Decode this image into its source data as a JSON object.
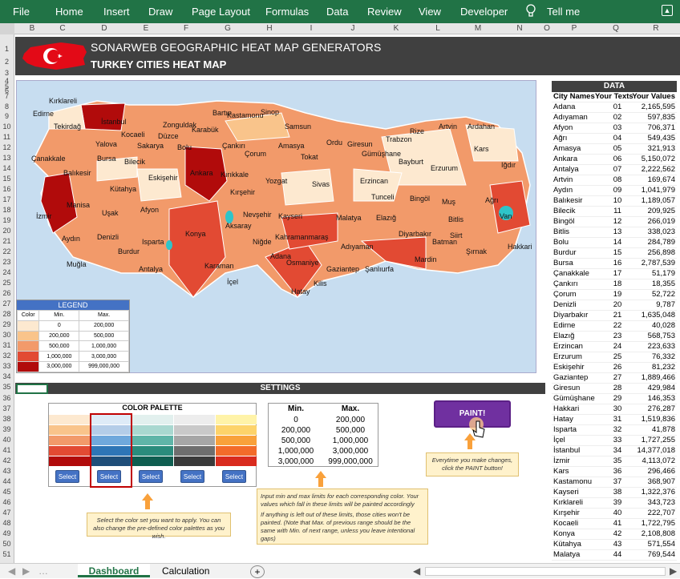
{
  "ribbon": {
    "tabs": [
      "File",
      "Home",
      "Insert",
      "Draw",
      "Page Layout",
      "Formulas",
      "Data",
      "Review",
      "View",
      "Developer",
      "Tell me"
    ]
  },
  "columns": [
    "B",
    "C",
    "D",
    "E",
    "F",
    "G",
    "H",
    "I",
    "J",
    "K",
    "L",
    "M",
    "N",
    "O",
    "P",
    "Q",
    "R"
  ],
  "rows": [
    "1",
    "2",
    "3",
    "4",
    "5",
    "6",
    "7",
    "8",
    "9",
    "10",
    "11",
    "12",
    "13",
    "14",
    "15",
    "16",
    "17",
    "18",
    "19",
    "20",
    "21",
    "22",
    "23",
    "24",
    "25",
    "26",
    "27",
    "28",
    "29",
    "30",
    "31",
    "32",
    "33",
    "34",
    "35",
    "36",
    "37",
    "38",
    "39",
    "40",
    "41",
    "42",
    "43",
    "44",
    "45",
    "46",
    "47",
    "48",
    "49",
    "50",
    "51"
  ],
  "header": {
    "title": "SONARWEB GEOGRAPHIC HEAT MAP GENERATORS",
    "subtitle": "TURKEY CITIES HEAT MAP"
  },
  "map": {
    "cities": [
      {
        "n": "Kırklareli"
      },
      {
        "n": "Edirne"
      },
      {
        "n": "İstanbul"
      },
      {
        "n": "Tekirdağ"
      },
      {
        "n": "Kocaeli"
      },
      {
        "n": "Zonguldak"
      },
      {
        "n": "Bartın"
      },
      {
        "n": "Kastamonu"
      },
      {
        "n": "Sinop"
      },
      {
        "n": "Samsun"
      },
      {
        "n": "Karabük"
      },
      {
        "n": "Düzce"
      },
      {
        "n": "Yalova"
      },
      {
        "n": "Sakarya"
      },
      {
        "n": "Bolu"
      },
      {
        "n": "Çankırı"
      },
      {
        "n": "Çorum"
      },
      {
        "n": "Amasya"
      },
      {
        "n": "Ordu"
      },
      {
        "n": "Giresun"
      },
      {
        "n": "Trabzon"
      },
      {
        "n": "Rize"
      },
      {
        "n": "Artvin"
      },
      {
        "n": "Ardahan"
      },
      {
        "n": "Gümüşhane"
      },
      {
        "n": "Kars"
      },
      {
        "n": "Bayburt"
      },
      {
        "n": "Tokat"
      },
      {
        "n": "Çanakkale"
      },
      {
        "n": "Bursa"
      },
      {
        "n": "Bilecik"
      },
      {
        "n": "Balıkesir"
      },
      {
        "n": "Eskişehir"
      },
      {
        "n": "Ankara"
      },
      {
        "n": "Kırıkkale"
      },
      {
        "n": "Erzurum"
      },
      {
        "n": "Iğdır"
      },
      {
        "n": "Kütahya"
      },
      {
        "n": "Yozgat"
      },
      {
        "n": "Sivas"
      },
      {
        "n": "Erzincan"
      },
      {
        "n": "Kırşehir"
      },
      {
        "n": "Tunceli"
      },
      {
        "n": "Bingöl"
      },
      {
        "n": "Ağrı"
      },
      {
        "n": "Manisa"
      },
      {
        "n": "Uşak"
      },
      {
        "n": "Afyon"
      },
      {
        "n": "Muş"
      },
      {
        "n": "Nevşehir"
      },
      {
        "n": "Kayseri"
      },
      {
        "n": "Malatya"
      },
      {
        "n": "Elazığ"
      },
      {
        "n": "Bitlis"
      },
      {
        "n": "Van"
      },
      {
        "n": "İzmir"
      },
      {
        "n": "Aksaray"
      },
      {
        "n": "Konya"
      },
      {
        "n": "Diyarbakır"
      },
      {
        "n": "Aydın"
      },
      {
        "n": "Denizli"
      },
      {
        "n": "Kahramanmaraş"
      },
      {
        "n": "Siirt"
      },
      {
        "n": "Isparta"
      },
      {
        "n": "Niğde"
      },
      {
        "n": "Adıyaman"
      },
      {
        "n": "Batman"
      },
      {
        "n": "Burdur"
      },
      {
        "n": "Şırnak"
      },
      {
        "n": "Hakkari"
      },
      {
        "n": "Muğla"
      },
      {
        "n": "Antalya"
      },
      {
        "n": "Karaman"
      },
      {
        "n": "Adana"
      },
      {
        "n": "Mardin"
      },
      {
        "n": "Osmaniye"
      },
      {
        "n": "Gaziantep"
      },
      {
        "n": "Şanlıurfa"
      },
      {
        "n": "İçel"
      },
      {
        "n": "Kilis"
      },
      {
        "n": "Hatay"
      }
    ]
  },
  "legend": {
    "title": "LEGEND",
    "col_color": "Color",
    "col_min": "Min.",
    "col_max": "Max.",
    "rows": [
      {
        "min": "0",
        "max": "200,000",
        "color": "#fde9d0"
      },
      {
        "min": "200,000",
        "max": "500,000",
        "color": "#f9c48b"
      },
      {
        "min": "500,000",
        "max": "1,000,000",
        "color": "#f29a6a"
      },
      {
        "min": "1,000,000",
        "max": "3,000,000",
        "color": "#e24a33"
      },
      {
        "min": "3,000,000",
        "max": "999,000,000",
        "color": "#b10b0b"
      }
    ]
  },
  "data_table": {
    "title": "DATA",
    "col1": "City Names",
    "col2": "Your Texts",
    "col3": "Your Values",
    "rows": [
      [
        "Adana",
        "01",
        "2,165,595"
      ],
      [
        "Adıyaman",
        "02",
        "597,835"
      ],
      [
        "Afyon",
        "03",
        "706,371"
      ],
      [
        "Ağrı",
        "04",
        "549,435"
      ],
      [
        "Amasya",
        "05",
        "321,913"
      ],
      [
        "Ankara",
        "06",
        "5,150,072"
      ],
      [
        "Antalya",
        "07",
        "2,222,562"
      ],
      [
        "Artvin",
        "08",
        "169,674"
      ],
      [
        "Aydın",
        "09",
        "1,041,979"
      ],
      [
        "Balıkesir",
        "10",
        "1,189,057"
      ],
      [
        "Bilecik",
        "11",
        "209,925"
      ],
      [
        "Bingöl",
        "12",
        "266,019"
      ],
      [
        "Bitlis",
        "13",
        "338,023"
      ],
      [
        "Bolu",
        "14",
        "284,789"
      ],
      [
        "Burdur",
        "15",
        "256,898"
      ],
      [
        "Bursa",
        "16",
        "2,787,539"
      ],
      [
        "Çanakkale",
        "17",
        "51,179"
      ],
      [
        "Çankırı",
        "18",
        "18,355"
      ],
      [
        "Çorum",
        "19",
        "52,722"
      ],
      [
        "Denizli",
        "20",
        "9,787"
      ],
      [
        "Diyarbakır",
        "21",
        "1,635,048"
      ],
      [
        "Edirne",
        "22",
        "40,028"
      ],
      [
        "Elazığ",
        "23",
        "568,753"
      ],
      [
        "Erzincan",
        "24",
        "223,633"
      ],
      [
        "Erzurum",
        "25",
        "76,332"
      ],
      [
        "Eskişehir",
        "26",
        "81,232"
      ],
      [
        "Gaziantep",
        "27",
        "1,889,466"
      ],
      [
        "Giresun",
        "28",
        "429,984"
      ],
      [
        "Gümüşhane",
        "29",
        "146,353"
      ],
      [
        "Hakkari",
        "30",
        "276,287"
      ],
      [
        "Hatay",
        "31",
        "1,519,836"
      ],
      [
        "Isparta",
        "32",
        "41,878"
      ],
      [
        "İçel",
        "33",
        "1,727,255"
      ],
      [
        "İstanbul",
        "34",
        "14,377,018"
      ],
      [
        "İzmir",
        "35",
        "4,113,072"
      ],
      [
        "Kars",
        "36",
        "296,466"
      ],
      [
        "Kastamonu",
        "37",
        "368,907"
      ],
      [
        "Kayseri",
        "38",
        "1,322,376"
      ],
      [
        "Kırklareli",
        "39",
        "343,723"
      ],
      [
        "Kırşehir",
        "40",
        "222,707"
      ],
      [
        "Kocaeli",
        "41",
        "1,722,795"
      ],
      [
        "Konya",
        "42",
        "2,108,808"
      ],
      [
        "Kütahya",
        "43",
        "571,554"
      ],
      [
        "Malatya",
        "44",
        "769,544"
      ]
    ]
  },
  "settings": {
    "title": "SETTINGS",
    "palette_title": "COLOR PALETTE",
    "select_label": "Select",
    "palettes": [
      [
        "#fde9d0",
        "#f9c48b",
        "#f29a6a",
        "#e24a33",
        "#b10b0b"
      ],
      [
        "#deebf7",
        "#b4cde8",
        "#6fa8dc",
        "#2e75b6",
        "#1f4e79"
      ],
      [
        "#e2f0ee",
        "#a9d8d0",
        "#5fb5a8",
        "#2a8c7c",
        "#0f5e50"
      ],
      [
        "#ededed",
        "#c9c9c9",
        "#a6a6a6",
        "#6e6e6e",
        "#3a3a3a"
      ],
      [
        "#fff3a8",
        "#fdd36a",
        "#f9a13b",
        "#f36b2a",
        "#d92b1e"
      ]
    ],
    "minmax_min": "Min.",
    "minmax_max": "Max.",
    "minmax": [
      [
        "0",
        "200,000"
      ],
      [
        "200,000",
        "500,000"
      ],
      [
        "500,000",
        "1,000,000"
      ],
      [
        "1,000,000",
        "3,000,000"
      ],
      [
        "3,000,000",
        "999,000,000"
      ]
    ],
    "paint": "PAINT!",
    "note_paint": "Everytime you make changes, click the PAINT button!",
    "note_minmax_1": "Input min and max limits for each corresponding color. Your values which fall in these limits will be painted accordingly",
    "note_minmax_2": "If anything is left out of these limits, those cities won't be painted. (Note that Max. of previous range should be the same with Min. of next range, unless you leave intentional gaps)",
    "note_select": "Select the color set you want to apply. You can also change the pre-defined color palettes as you wish."
  },
  "sheets": {
    "active": "Dashboard",
    "other": "Calculation",
    "add": "+"
  }
}
